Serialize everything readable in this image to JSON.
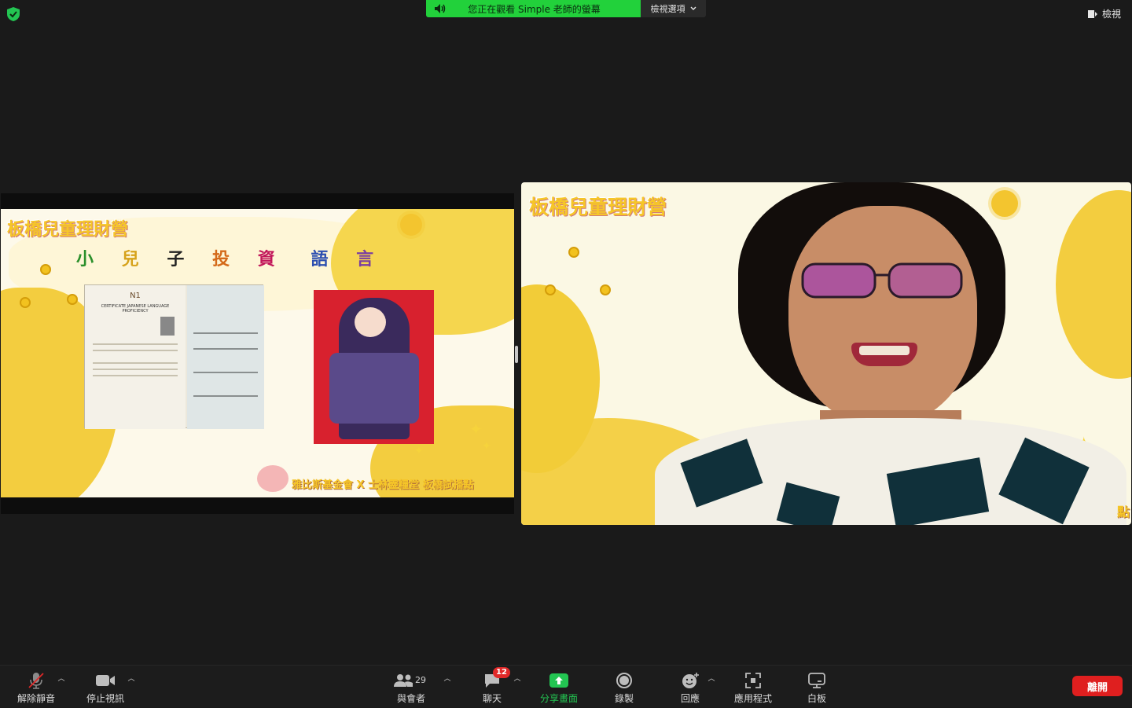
{
  "banner": {
    "status_text": "您正在觀看 Simple 老師的螢幕",
    "view_options_label": "檢視選項"
  },
  "top_right": {
    "view_label": "檢視"
  },
  "share": {
    "slide_title": "板橋兒童理財營",
    "slide_subtitle": [
      "小",
      "兒",
      "子",
      "投",
      "資",
      "語",
      "言"
    ],
    "certificate_title": "CERTIFICATE JAPANESE LANGUAGE PROFICIENCY",
    "certificate_badge": "N1",
    "footer": "雅比斯基金會 X 士林靈糧堂 板橋試播點"
  },
  "video": {
    "background_title": "板橋兒童理財營",
    "footer_fragment": "點"
  },
  "toolbar": {
    "unmute_label": "解除靜音",
    "stop_video_label": "停止視訊",
    "participants_label": "與會者",
    "participants_count": "29",
    "chat_label": "聊天",
    "chat_badge": "12",
    "share_screen_label": "分享畫面",
    "record_label": "錄製",
    "reactions_label": "回應",
    "apps_label": "應用程式",
    "whiteboard_label": "白板",
    "leave_label": "離開"
  },
  "colors": {
    "banner_green": "#22d13b",
    "leave_red": "#df1f1f",
    "share_green": "#23c552",
    "slide_yellow": "#f6c628"
  }
}
